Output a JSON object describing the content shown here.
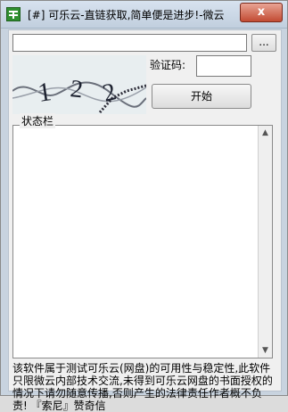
{
  "window": {
    "title": "[#] 可乐云-直链获取,简单便是进步!-微云..."
  },
  "titlebar": {
    "close_label": "x"
  },
  "toolbar": {
    "url_value": "",
    "browse_label": "..."
  },
  "captcha": {
    "label": "验证码:",
    "value": "",
    "image_text": [
      "1",
      "2",
      "2"
    ]
  },
  "actions": {
    "start_label": "开始"
  },
  "status": {
    "label": "状态栏",
    "log_text": ""
  },
  "notice": {
    "text": "该软件属于测试可乐云(网盘)的可用性与稳定性,此软件只限微云内部技术交流,未得到可乐云网盘的书面授权的情况下请勿随意传播,否则产生的法律责任作者概不负责!                『索尼』赞奇信"
  },
  "colors": {
    "frame": "#c8d3df",
    "client_bg": "#f0f0f0",
    "close_button": "#c24b33"
  }
}
